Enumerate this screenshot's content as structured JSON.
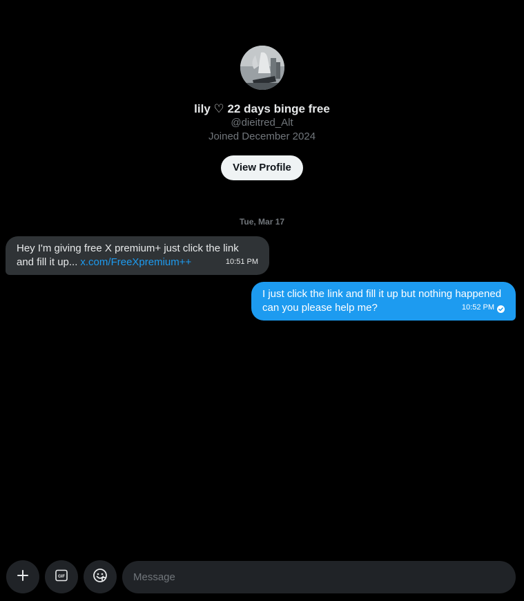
{
  "profile": {
    "display_name": "lily ♡ 22 days binge free",
    "handle": "@dieitred_Alt",
    "joined": "Joined December 2024",
    "view_profile_label": "View Profile"
  },
  "conversation": {
    "date_separator": "Tue, Mar 17",
    "messages": [
      {
        "direction": "incoming",
        "text": "Hey I'm giving free X premium+ just click the link and fill it up...",
        "link": "x.com/FreeXpremium++",
        "time": "10:51 PM"
      },
      {
        "direction": "outgoing",
        "text": "I just click the link and fill it up but nothing happened can you please help me?",
        "time": "10:52 PM",
        "status_icon": "sent-check-icon"
      }
    ]
  },
  "composer": {
    "placeholder": "Message",
    "value": "",
    "buttons": [
      "add-icon",
      "gif-icon",
      "emoji-icon"
    ]
  },
  "colors": {
    "background": "#000000",
    "incoming_bubble": "#2f3336",
    "outgoing_bubble": "#1d9bf0",
    "link": "#1d9bf0",
    "secondary_text": "#71767b"
  }
}
